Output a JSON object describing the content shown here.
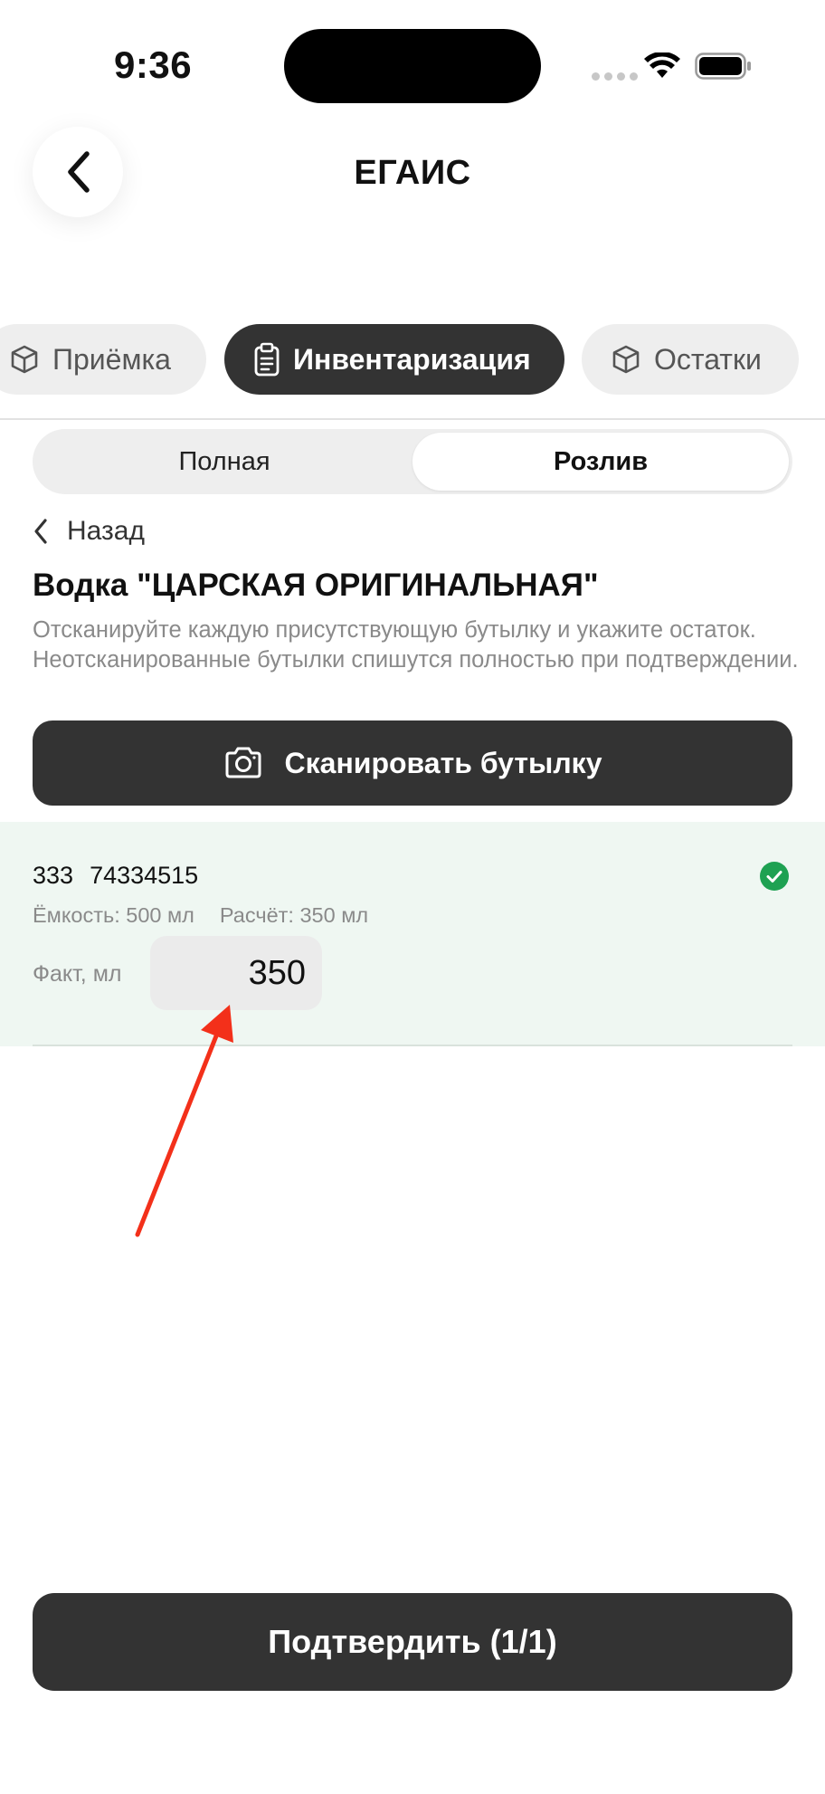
{
  "status_bar": {
    "time": "9:36"
  },
  "header": {
    "title": "ЕГАИС"
  },
  "tabs": [
    {
      "label": "Приёмка",
      "icon": "box-icon",
      "active": false
    },
    {
      "label": "Инвентаризация",
      "icon": "clipboard-icon",
      "active": true
    },
    {
      "label": "Остатки",
      "icon": "box-icon",
      "active": false
    }
  ],
  "segments": {
    "full": "Полная",
    "pour": "Розлив",
    "selected": "pour"
  },
  "back_link": {
    "label": "Назад"
  },
  "product": {
    "title": "Водка \"ЦАРСКАЯ ОРИГИНАЛЬНАЯ\"",
    "instructions": "Отсканируйте каждую присутствующую бутылку и укажите остаток. Неотсканированные бутылки спишутся полностью при подтверждении."
  },
  "scan_button": {
    "label": "Сканировать бутылку",
    "icon": "camera-icon"
  },
  "bottle": {
    "code_prefix": "333",
    "code": "74334515",
    "capacity": "Ёмкость: 500 мл",
    "calculated": "Расчёт: 350 мл",
    "fact_label": "Факт, мл",
    "fact_value": "350",
    "status_icon": "check-circle-icon"
  },
  "confirm_button": {
    "label": "Подтвердить (1/1)"
  },
  "colors": {
    "dark": "#333333",
    "chip_bg": "#eeeeee",
    "card_bg": "#eff7f2",
    "success": "#1ea152",
    "annotation": "#f3301a"
  }
}
